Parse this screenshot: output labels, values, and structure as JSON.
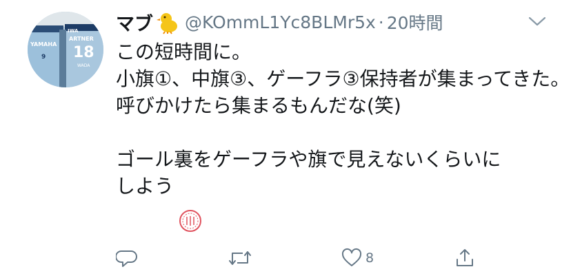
{
  "tweet": {
    "display_name": "マブ",
    "name_emoji": "chick-emoji",
    "handle": "@KOmmL1Yc8BLMr5x",
    "separator": "·",
    "timestamp": "20時間",
    "lines": [
      "この短時間に。",
      "小旗①、中旗③、ゲーフラ③保持者が集まってきた。",
      "呼びかけたら集まるもんだな(笑)",
      "",
      "ゴール裏をゲーフラや旗で見えないくらいに",
      "しよう"
    ],
    "line_emoji": "stamp-emoji"
  },
  "avatar": {
    "jersey_left_text": "YAMAHA",
    "jersey_left_number": "9",
    "jersey_right_name": "ARTNER",
    "jersey_right_number": "18",
    "jersey_right_small": "WADA",
    "banner_text": "IWA"
  },
  "actions": {
    "reply_icon": "reply-icon",
    "retweet_icon": "retweet-icon",
    "like_icon": "heart-icon",
    "like_count": "8",
    "share_icon": "share-icon"
  },
  "colors": {
    "text": "#14171a",
    "secondary": "#657786",
    "background": "#ffffff"
  }
}
